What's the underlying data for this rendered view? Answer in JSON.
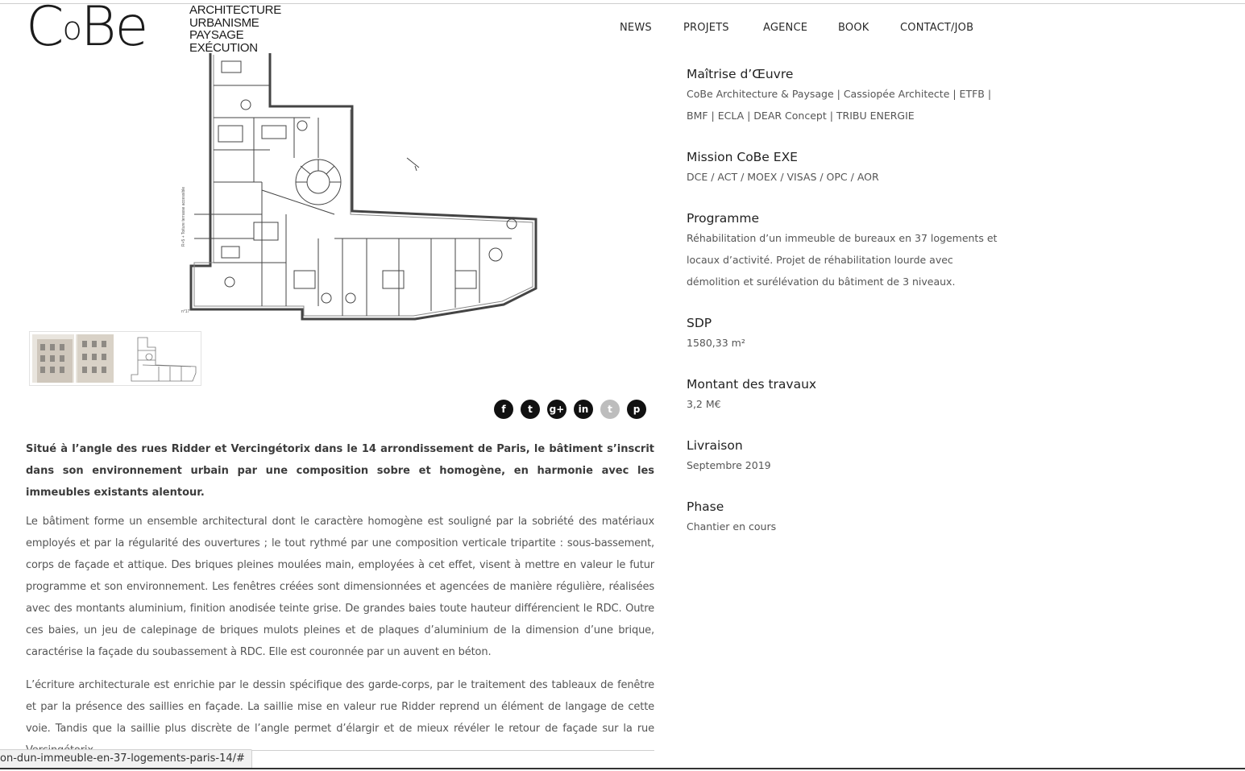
{
  "logo": {
    "mark_c": "C",
    "mark_o": "o",
    "mark_be": "Be",
    "lines": [
      "ARCHITECTURE",
      "URBANISME",
      "PAYSAGE",
      "EXÉCUTION"
    ]
  },
  "nav": {
    "items": [
      "NEWS",
      "PROJETS",
      "AGENCE",
      "BOOK",
      "CONTACT/JOB"
    ]
  },
  "social": {
    "icons": [
      "f",
      "t",
      "g+",
      "in",
      "t",
      "p"
    ],
    "names": [
      "facebook",
      "twitter",
      "google-plus",
      "linkedin",
      "tumblr",
      "pinterest"
    ]
  },
  "content": {
    "lead": "Situé à l’angle des rues Ridder et Vercingétorix dans le 14 arrondissement de Paris, le bâtiment s’inscrit dans son environnement urbain par une composition sobre et homogène, en harmonie avec les immeubles existants alentour.",
    "paragraphs": [
      "Le bâtiment forme un ensemble architectural dont le caractère homogène est souligné par la sobriété des matériaux employés et par la régularité des ouvertures ; le tout rythmé par une composition verticale tripartite : sous-bassement, corps de façade et attique. Des briques pleines moulées main, employées à cet effet, visent à mettre en valeur le futur programme et son environnement. Les fenêtres créées sont dimensionnées et agencées de manière régulière, réalisées avec des montants aluminium, finition anodisée teinte grise. De grandes baies toute hauteur différencient le RDC. Outre ces baies, un jeu de calepinage de briques mulots pleines et de plaques d’aluminium de la dimension d’une brique, caractérise la façade du soubassement à RDC. Elle est couronnée par un auvent en béton.",
      "L’écriture architecturale est enrichie par le dessin spécifique des garde-corps, par le traitement des tableaux de fenêtre et par la présence des saillies en façade. La saillie mise en valeur rue Ridder reprend un élément de langage de cette voie. Tandis que la saillie plus discrète de l’angle permet d’élargir et de mieux révéler le retour de façade sur la rue Vercingétorix"
    ]
  },
  "info": [
    {
      "title": "Maîtrise d’Œuvre",
      "lines": [
        "CoBe Architecture & Paysage | Cassiopée Architecte | ETFB |",
        "BMF | ECLA | DEAR Concept | TRIBU ENERGIE"
      ]
    },
    {
      "title": "Mission CoBe EXE",
      "lines": [
        "DCE / ACT / MOEX / VISAS / OPC / AOR"
      ]
    },
    {
      "title": "Programme",
      "lines": [
        "Réhabilitation d’un immeuble de bureaux en 37 logements et",
        "locaux d’activité. Projet de réhabilitation lourde avec",
        "démolition et surélévation du bâtiment de 3 niveaux."
      ]
    },
    {
      "title": "SDP",
      "lines": [
        "1580,33 m²"
      ]
    },
    {
      "title": "Montant des travaux",
      "lines": [
        "3,2 M€"
      ]
    },
    {
      "title": "Livraison",
      "lines": [
        "Septembre 2019"
      ]
    },
    {
      "title": "Phase",
      "lines": [
        "Chantier en cours"
      ]
    }
  ],
  "plan": {
    "side_label": "R+5 + Toiture terrasse accessible",
    "corner_label": "n°17"
  },
  "status_url": "on-dun-immeuble-en-37-logements-paris-14/#"
}
